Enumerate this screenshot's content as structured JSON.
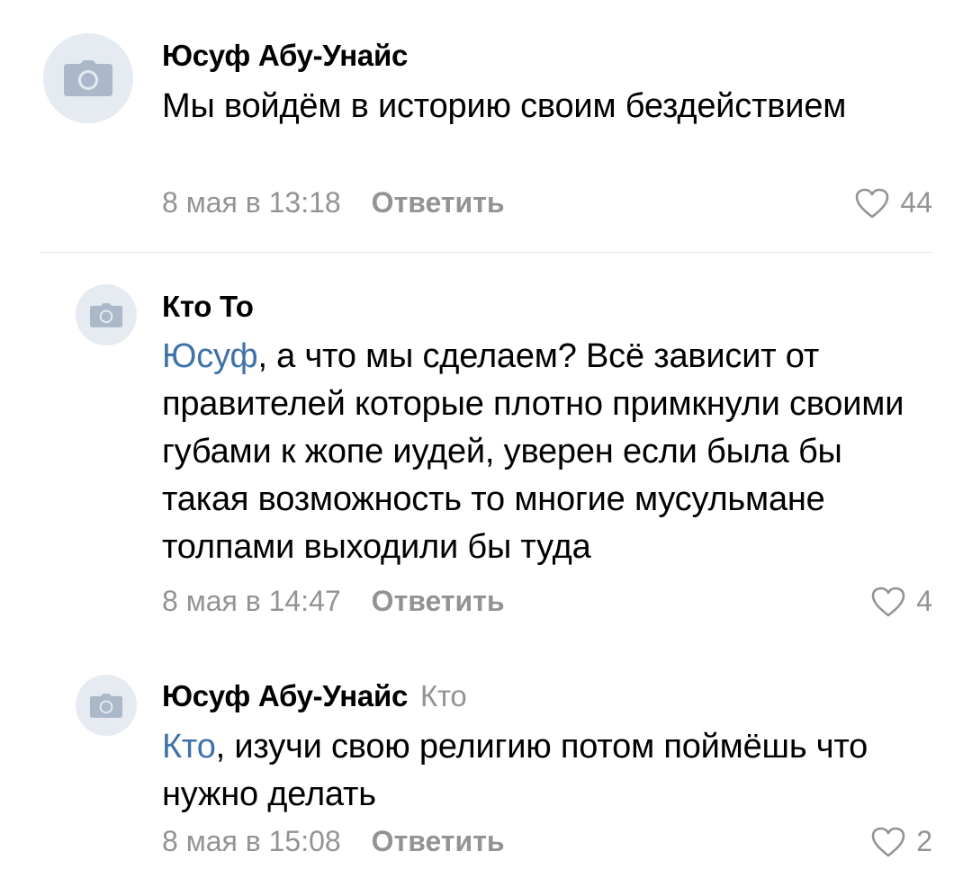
{
  "comments": [
    {
      "author": "Юсуф Абу-Унайс",
      "reply_to": "",
      "mention": "",
      "text": "Мы войдём в историю своим бездействием",
      "date": "8 мая в 13:18",
      "reply_label": "Ответить",
      "likes": "44"
    },
    {
      "author": "Кто То",
      "reply_to": "",
      "mention": "Юсуф",
      "text": ", а что мы сделаем? Всё зависит от правителей которые плотно примкнули своими губами к жопе иудей, уверен если была бы такая возможность то многие мусульмане толпами выходили бы туда",
      "date": "8 мая в 14:47",
      "reply_label": "Ответить",
      "likes": "4"
    },
    {
      "author": "Юсуф Абу-Унайс",
      "reply_to": "Кто",
      "mention": "Кто",
      "text": ", изучи свою религию потом поймёшь что нужно делать",
      "date": "8 мая в 15:08",
      "reply_label": "Ответить",
      "likes": "2"
    }
  ],
  "colors": {
    "mention": "#3f72a8",
    "secondary_text": "#939393",
    "avatar_bg": "#e5ebf1",
    "avatar_icon": "#aab8c9"
  },
  "icons": {
    "avatar": "camera-icon",
    "like": "heart-outline-icon"
  }
}
